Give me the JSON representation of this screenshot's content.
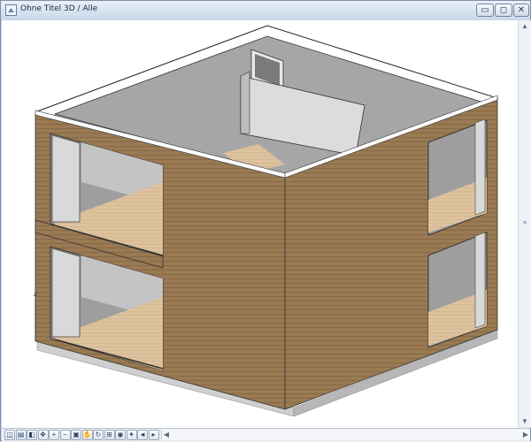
{
  "window": {
    "title": "Ohne Titel 3D / Alle",
    "icon": "app-3d-window-icon",
    "controls": {
      "minimize": "▭",
      "maximize": "◻",
      "close": "✕"
    }
  },
  "viewport": {
    "axis_label": "z",
    "colors": {
      "cladding": "#9a7a53",
      "wall_gray": "#9c9c9c",
      "wall_light": "#cfcfcf",
      "floor_wood": "#ddc29e",
      "slab": "#d6d6d6",
      "background": "#ffffff"
    }
  },
  "scrollbars": {
    "up": "▲",
    "down": "▼",
    "left": "◀",
    "right": "▶",
    "thumb": "≡"
  },
  "toolbar": [
    {
      "name": "zoom-window-icon",
      "glyph": "◫"
    },
    {
      "name": "display-mode-icon",
      "glyph": "▤"
    },
    {
      "name": "shading-icon",
      "glyph": "◧"
    },
    {
      "name": "orbit-icon",
      "glyph": "✥"
    },
    {
      "name": "zoom-in-icon",
      "glyph": "+"
    },
    {
      "name": "zoom-out-icon",
      "glyph": "−"
    },
    {
      "name": "fit-in-window-icon",
      "glyph": "▣"
    },
    {
      "name": "pan-hand-icon",
      "glyph": "✋"
    },
    {
      "name": "rotate-view-icon",
      "glyph": "↻"
    },
    {
      "name": "navigator-icon",
      "glyph": "⊞"
    },
    {
      "name": "camera-icon",
      "glyph": "◉"
    },
    {
      "name": "walk-mode-icon",
      "glyph": "✦"
    },
    {
      "name": "previous-view-icon",
      "glyph": "◄"
    },
    {
      "name": "next-view-icon",
      "glyph": "▸"
    }
  ]
}
